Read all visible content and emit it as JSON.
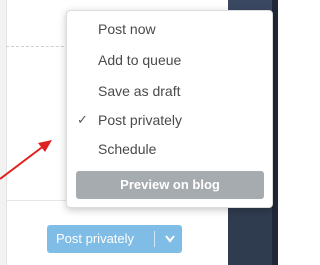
{
  "menu": {
    "items": [
      {
        "label": "Post now",
        "checked": false
      },
      {
        "label": "Add to queue",
        "checked": false
      },
      {
        "label": "Save as draft",
        "checked": false
      },
      {
        "label": "Post privately",
        "checked": true
      },
      {
        "label": "Schedule",
        "checked": false
      }
    ],
    "preview_label": "Preview on blog",
    "checkmark": "✓"
  },
  "post_button": {
    "label": "Post privately",
    "icon": "chevron-down-icon",
    "color": "#7fbce6"
  },
  "annotation": {
    "arrow_color": "#e02020"
  }
}
